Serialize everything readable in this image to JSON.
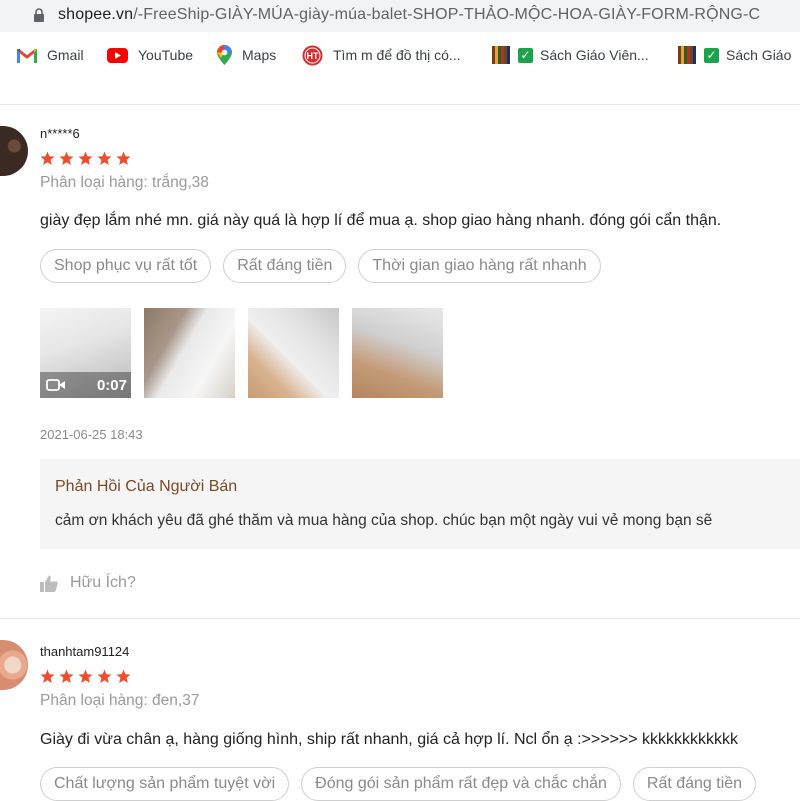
{
  "browser": {
    "url_domain": "shopee.vn",
    "url_path": "/-FreeShip-GIÀY-MÚA-giày-múa-balet-SHOP-THẢO-MỘC-HOA-GIÀY-FORM-RỘNG-C",
    "bookmarks": [
      {
        "label": "Gmail",
        "icon": "gmail-icon"
      },
      {
        "label": "YouTube",
        "icon": "youtube-icon"
      },
      {
        "label": "Maps",
        "icon": "maps-icon"
      },
      {
        "label": "Tìm m để đồ thị có...",
        "icon": "ht-icon",
        "icon_text": "HT"
      },
      {
        "label": "Sách Giáo Viên...",
        "icon": "book-check-icon"
      },
      {
        "label": "Sách Giáo",
        "icon": "book-check-icon"
      }
    ]
  },
  "colors": {
    "star": "#ee4d2d",
    "seller_title": "#7a4a26",
    "seller_bg": "#f5f5f5"
  },
  "reviews": [
    {
      "username": "n*****6",
      "rating": 5,
      "variation": "Phân loại hàng: trắng,38",
      "comment": "giày đẹp lắm nhé mn. giá này quá là hợp lí để mua ạ. shop giao hàng nhanh. đóng gói cẩn thận.",
      "tags": [
        "Shop phục vụ rất tốt",
        "Rất đáng tiền",
        "Thời gian giao hàng rất nhanh"
      ],
      "video_duration": "0:07",
      "date": "2021-06-25 18:43",
      "seller_reply_title": "Phản Hồi Của Người Bán",
      "seller_reply": "cảm ơn khách yêu đã ghé thăm và mua hàng của shop. chúc bạn một ngày vui vẻ mong bạn sẽ",
      "helpful": "Hữu Ích?"
    },
    {
      "username": "thanhtam91124",
      "rating": 5,
      "variation": "Phân loại hàng: đen,37",
      "comment": "Giày đi vừa chân ạ, hàng giống hình, ship rất nhanh, giá cả hợp lí. Ncl ổn ạ :>>>>>> kkkkkkkkkkkk",
      "tags": [
        "Chất lượng sản phẩm tuyệt vời",
        "Đóng gói sản phẩm rất đẹp và chắc chắn",
        "Rất đáng tiền"
      ]
    }
  ]
}
